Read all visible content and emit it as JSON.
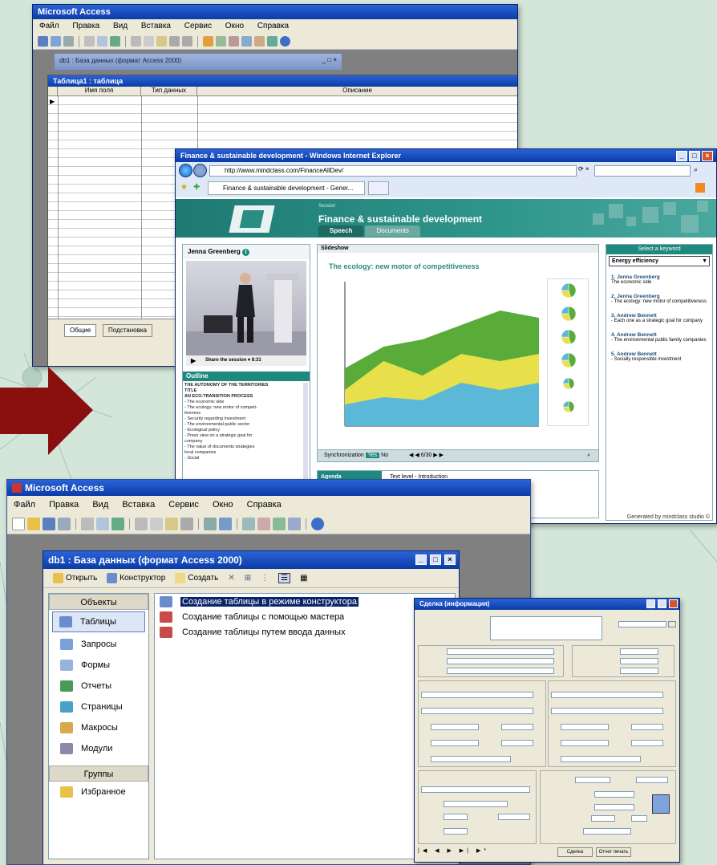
{
  "colors": {
    "background": "#d4e6d9",
    "xp_title": "#0b3ca6",
    "teal": "#1e8a7f",
    "arrow": "#8a0f0f"
  },
  "top_access": {
    "title": "Microsoft Access",
    "menu": [
      "Файл",
      "Правка",
      "Вид",
      "Вставка",
      "Сервис",
      "Окно",
      "Справка"
    ],
    "db_window_title": "db1 : База данных (формат Access 2000)",
    "table_window_title": "Таблица1 : таблица",
    "columns": [
      "Имя поля",
      "Тип данных",
      "Описание"
    ],
    "tabs": [
      "Общие",
      "Подстановка"
    ]
  },
  "browser": {
    "title": "Finance & sustainable development - Windows Internet Explorer",
    "url": "http://www.mindclass.com/FinanceAllDev/",
    "tab_label": "Finance & sustainable development - Gener...",
    "banner_title": "Finance & sustainable development",
    "banner_sub": "Session",
    "tabs": [
      "Speech",
      "Documents"
    ],
    "speaker": "Jenna Greenberg",
    "player_label": "Share the session ▾ 8:31",
    "slide_label": "Slideshow",
    "chart_title": "The ecology: new motor of competitiveness",
    "outline_label": "Outline",
    "outline": [
      "THE AUTONOMY OF THE TERRITORIES",
      "TITLE",
      "AN ECO-TRANSITION PROCESS",
      "- The economic side",
      "- The ecology: new motor of competi-",
      "  tiveness",
      "- Security regarding investment",
      "- The environmental public sector",
      "- Ecological policy",
      "- Press view on a strategic goal for",
      "  company",
      "- The value of documents strategies",
      "  local companies",
      "- Social"
    ],
    "sync_label": "Synchronization",
    "sync_yes": "Yes",
    "sync_no": "No",
    "sync_counter": "6/30",
    "agenda_label": "Agenda",
    "agenda_text": "Text level - Introduction",
    "keyword_head": "Select a keyword",
    "keyword_value": "Energy efficiency",
    "speakers": [
      {
        "name": "1. Jenna Greenberg",
        "desc": "The economic side"
      },
      {
        "name": "2. Jenna Greenberg",
        "desc": "- The ecology: new motor of competitiveness"
      },
      {
        "name": "3. Andrew Bennett",
        "desc": "- Each one as a strategic goal for company"
      },
      {
        "name": "4. Andrew Bennett",
        "desc": "- The environmental public family companies"
      },
      {
        "name": "5. Andrew Bennett",
        "desc": "- Socially responsible investment"
      }
    ],
    "footer": "Generated by mindclass studio ©"
  },
  "access": {
    "title": "Microsoft Access",
    "menu": [
      "Файл",
      "Правка",
      "Вид",
      "Вставка",
      "Сервис",
      "Окно",
      "Справка"
    ],
    "db_title": "db1 : База данных (формат Access 2000)",
    "db_toolbar": [
      "Открыть",
      "Конструктор",
      "Создать"
    ],
    "objects_header": "Объекты",
    "objects": [
      "Таблицы",
      "Запросы",
      "Формы",
      "Отчеты",
      "Страницы",
      "Макросы",
      "Модули"
    ],
    "groups_header": "Группы",
    "groups": [
      "Избранное"
    ],
    "list_items": [
      "Создание таблицы в режиме конструктора",
      "Создание таблицы с помощью мастера",
      "Создание таблицы путем ввода данных"
    ]
  },
  "form": {
    "title": "Сделка (информация)",
    "button_ok": "Сделка",
    "button_print": "Отчет печать"
  },
  "chart_data": {
    "type": "area",
    "title": "The ecology: new motor of competitiveness",
    "x": [
      0,
      1,
      2,
      3,
      4,
      5
    ],
    "series": [
      {
        "values": [
          15,
          20,
          18,
          30,
          25,
          30
        ]
      },
      {
        "values": [
          25,
          45,
          35,
          50,
          45,
          50
        ]
      },
      {
        "values": [
          40,
          55,
          60,
          70,
          80,
          75
        ]
      }
    ],
    "ylim": [
      0,
      100
    ]
  }
}
